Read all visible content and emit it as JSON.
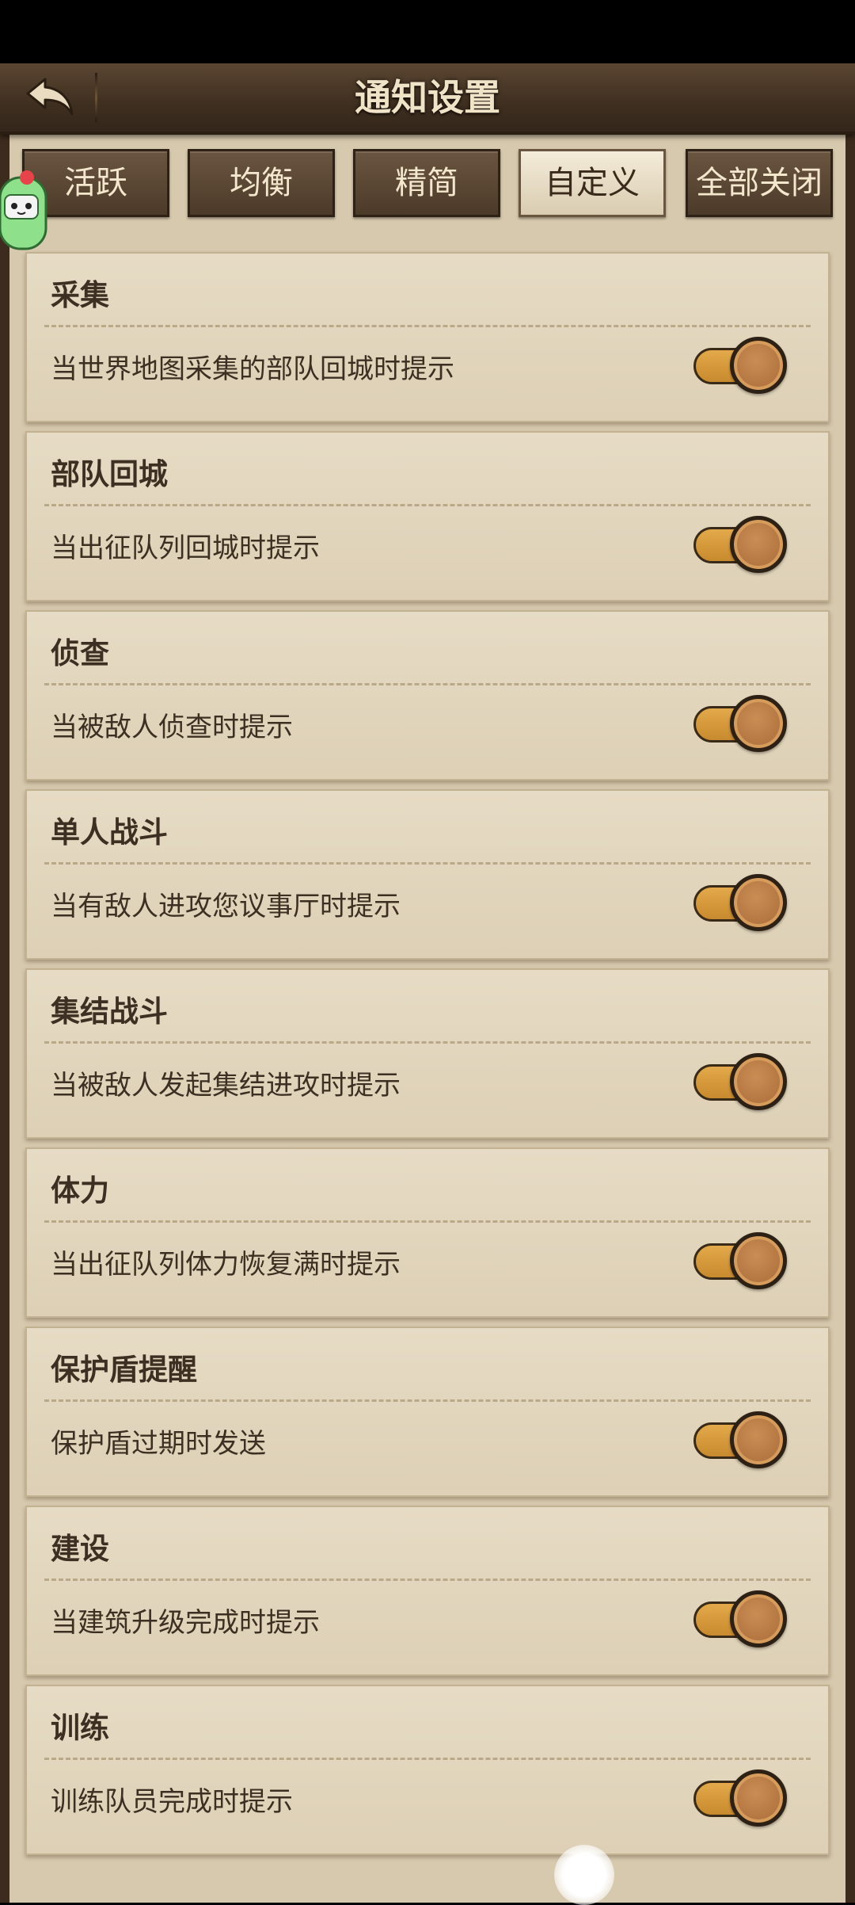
{
  "header": {
    "title": "通知设置",
    "back_icon": "back-arrow-icon"
  },
  "tabs": [
    {
      "label": "活跃",
      "active": false
    },
    {
      "label": "均衡",
      "active": false
    },
    {
      "label": "精简",
      "active": false
    },
    {
      "label": "自定义",
      "active": true
    },
    {
      "label": "全部关闭",
      "active": false
    }
  ],
  "settings": [
    {
      "title": "采集",
      "description": "当世界地图采集的部队回城时提示",
      "enabled": true
    },
    {
      "title": "部队回城",
      "description": "当出征队列回城时提示",
      "enabled": true
    },
    {
      "title": "侦查",
      "description": "当被敌人侦查时提示",
      "enabled": true
    },
    {
      "title": "单人战斗",
      "description": "当有敌人进攻您议事厅时提示",
      "enabled": true
    },
    {
      "title": "集结战斗",
      "description": "当被敌人发起集结进攻时提示",
      "enabled": true
    },
    {
      "title": "体力",
      "description": "当出征队列体力恢复满时提示",
      "enabled": true
    },
    {
      "title": "保护盾提醒",
      "description": "保护盾过期时发送",
      "enabled": true
    },
    {
      "title": "建设",
      "description": "当建筑升级完成时提示",
      "enabled": true
    },
    {
      "title": "训练",
      "description": "训练队员完成时提示",
      "enabled": true
    }
  ],
  "colors": {
    "toggle_on": "#d89a3c",
    "panel_bg": "#d7c9ad",
    "header_bg": "#4a3826"
  }
}
